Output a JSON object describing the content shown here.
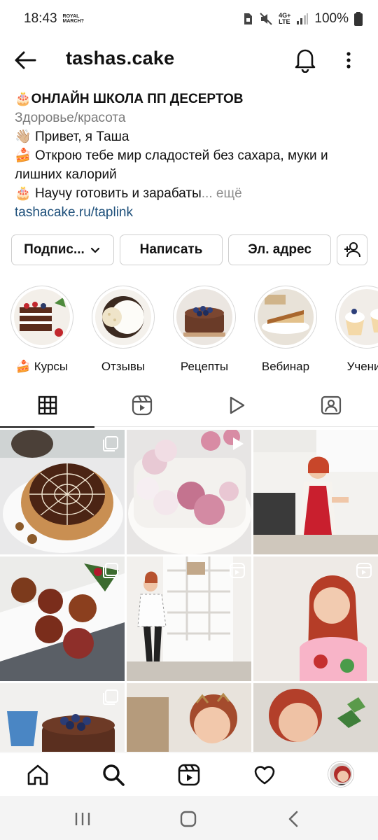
{
  "status_bar": {
    "time": "18:43",
    "carrier_line1": "ROYAL",
    "carrier_line2": "MARCH?",
    "network": "4G+",
    "network_sub": "LTE",
    "battery_percent": "100%"
  },
  "header": {
    "username": "tashas.cake",
    "icons": [
      "back-arrow-icon",
      "bell-icon",
      "more-vertical-icon"
    ]
  },
  "bio": {
    "name": "ОНЛАЙН ШКОЛА ПП ДЕСЕРТОВ",
    "category": "Здоровье/красота",
    "line1": "Привет, я Таша",
    "line2": "Открою тебе мир сладостей без сахара, муки и лишних калорий",
    "line3": "Научу готовить и зарабаты",
    "ellipsis": "...",
    "more_label": "ещё",
    "link": "tashacake.ru/taplink"
  },
  "buttons": {
    "follow": "Подпис...",
    "message": "Написать",
    "email": "Эл. адрес"
  },
  "highlights": [
    {
      "label": "Курсы"
    },
    {
      "label": "Отзывы"
    },
    {
      "label": "Рецепты"
    },
    {
      "label": "Вебинар"
    },
    {
      "label": "Ученич"
    }
  ],
  "tabs": [
    "grid-icon",
    "reels-icon",
    "play-icon",
    "tagged-icon"
  ],
  "colors": {
    "link": "#1d4f7a",
    "secondary_text": "#7a7a7a",
    "border": "#cfcfcf"
  }
}
